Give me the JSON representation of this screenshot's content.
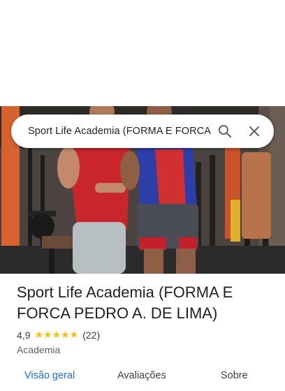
{
  "search": {
    "query": "Sport Life Academia (FORMA E FORCA PEDRO A. DE LIMA)"
  },
  "place": {
    "name": "Sport Life Academia (FORMA E FORCA PEDRO A. DE LIMA)",
    "rating": "4,9",
    "stars": "★★★★★",
    "review_count": "(22)",
    "category": "Academia"
  },
  "tabs": [
    {
      "label": "Visão geral",
      "active": true
    },
    {
      "label": "Avaliações",
      "active": false
    },
    {
      "label": "Sobre",
      "active": false
    }
  ],
  "colors": {
    "accent": "#1a73e8",
    "star": "#fbbc04",
    "text": "#202124"
  },
  "icons": [
    "search-icon",
    "close-icon"
  ]
}
